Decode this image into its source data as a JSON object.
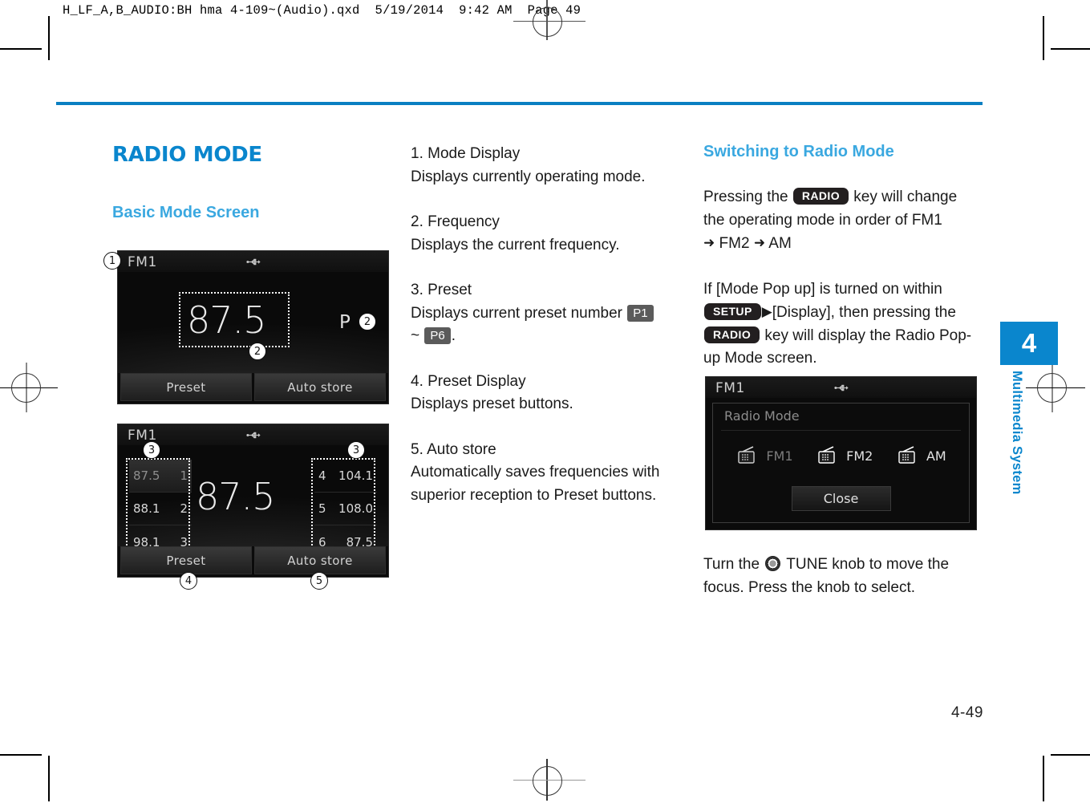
{
  "print_header": "H_LF_A,B_AUDIO:BH hma 4-109~(Audio).qxd  5/19/2014  9:42 AM  Page 49",
  "chapter": {
    "number": "4",
    "label": "Multimedia System"
  },
  "folio": "4-49",
  "accent_color": "#0a86cd",
  "rule_color": "#0a7fc2",
  "col1": {
    "section_title": "RADIO MODE",
    "subsection_title": "Basic Mode Screen",
    "screen_basic": {
      "mode": "FM1",
      "usb_icon": "usb-icon",
      "frequency": "87.5",
      "preset_indicator": "P",
      "buttons": [
        "Preset",
        "Auto store"
      ],
      "callouts": [
        "1",
        "2",
        "2"
      ]
    },
    "screen_preset": {
      "mode": "FM1",
      "usb_icon": "usb-icon",
      "frequency": "87.5",
      "presets_left": [
        {
          "freq": "87.5",
          "num": "1",
          "selected": true
        },
        {
          "freq": "88.1",
          "num": "2",
          "selected": false
        },
        {
          "freq": "98.1",
          "num": "3",
          "selected": false
        }
      ],
      "presets_right": [
        {
          "freq": "104.1",
          "num": "4",
          "selected": false
        },
        {
          "freq": "108.0",
          "num": "5",
          "selected": false
        },
        {
          "freq": "87.5",
          "num": "6",
          "selected": false
        }
      ],
      "buttons": [
        "Preset",
        "Auto store"
      ],
      "callouts": [
        "3",
        "3",
        "4",
        "5"
      ]
    }
  },
  "col2": {
    "items": [
      {
        "heading": "1. Mode Display",
        "body": "Displays currently operating mode."
      },
      {
        "heading": "2. Frequency",
        "body": "Displays the current frequency."
      },
      {
        "heading": "3. Preset",
        "body_pre": "Displays current preset number ",
        "badge1": "P1",
        "body_mid": "~ ",
        "badge2": "P6",
        "body_post": "."
      },
      {
        "heading": "4. Preset Display",
        "body": "Displays preset buttons."
      },
      {
        "heading": "5. Auto store",
        "body": "Automatically saves frequencies with superior reception to Preset buttons."
      }
    ]
  },
  "col3": {
    "section_title": "Switching to Radio Mode",
    "para1_pre": "Pressing the ",
    "para1_key": "RADIO",
    "para1_post": " key will change the operating mode in order of FM1",
    "para1_line3": "FM2",
    "para1_line3b": "AM",
    "para2_pre": "If [Mode Pop up] is turned on within",
    "para2_key1": "SETUP",
    "para2_mid": "[Display], then pressing the",
    "para2_key2": "RADIO",
    "para2_post": " key will display the Radio Pop-up Mode screen.",
    "screen_popup": {
      "mode": "FM1",
      "usb_icon": "usb-icon",
      "title": "Radio Mode",
      "modes": [
        {
          "label": "FM1",
          "icon": "radio-icon",
          "dim": true
        },
        {
          "label": "FM2",
          "icon": "radio-icon",
          "dim": false
        },
        {
          "label": "AM",
          "icon": "radio-icon",
          "dim": false
        }
      ],
      "close_label": "Close"
    },
    "para3_pre": "Turn the ",
    "para3_knob": "tune-knob-icon",
    "para3_post": " TUNE knob to move the focus. Press the knob to select."
  }
}
